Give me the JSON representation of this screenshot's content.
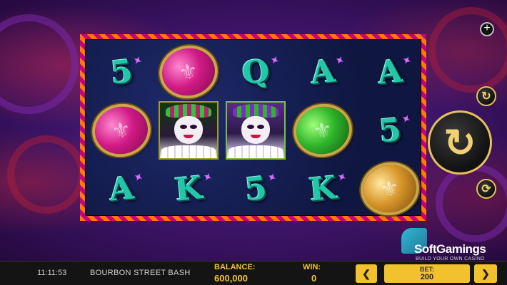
{
  "game": {
    "title": "BOURBON STREET BASH",
    "time": "11:11:53"
  },
  "reels": {
    "rows": [
      [
        {
          "type": "letter",
          "symbol": "5"
        },
        {
          "type": "coin",
          "color": "#d21a86",
          "icon": "fleur-de-lis-icon"
        },
        {
          "type": "letter",
          "symbol": "Q"
        },
        {
          "type": "letter",
          "symbol": "A"
        },
        {
          "type": "letter",
          "symbol": "A"
        }
      ],
      [
        {
          "type": "coin",
          "color": "#d21a86",
          "icon": "fleur-de-lis-icon"
        },
        {
          "type": "jester",
          "variant": "male"
        },
        {
          "type": "jester",
          "variant": "female"
        },
        {
          "type": "coin",
          "color": "#2fb52a",
          "icon": "fleur-de-lis-icon"
        },
        {
          "type": "letter",
          "symbol": "5"
        }
      ],
      [
        {
          "type": "letter",
          "symbol": "A"
        },
        {
          "type": "letter",
          "symbol": "K"
        },
        {
          "type": "letter",
          "symbol": "5"
        },
        {
          "type": "letter",
          "symbol": "K"
        },
        {
          "type": "coin",
          "color": "#d8952a",
          "icon": "fleur-de-lis-icon"
        }
      ]
    ]
  },
  "controls": {
    "plus_label": "+",
    "autoplay_icon": "autoplay-icon",
    "spin_icon": "spin-arrow-icon",
    "quickspin_icon": "quick-spin-icon",
    "prev_label": "❮",
    "next_label": "❯"
  },
  "status": {
    "balance_label": "BALANCE:",
    "balance_value": "600,000",
    "win_label": "WIN:",
    "win_value": "0",
    "bet_label": "BET:",
    "bet_value": "200"
  },
  "branding": {
    "name": "SoftGamings",
    "tagline": "BUILD YOUR OWN CASINO"
  },
  "colors": {
    "accent": "#f3c330",
    "frame_a": "#ff7a00",
    "frame_b": "#c8007a",
    "symbol_teal": "#22c7a8"
  }
}
